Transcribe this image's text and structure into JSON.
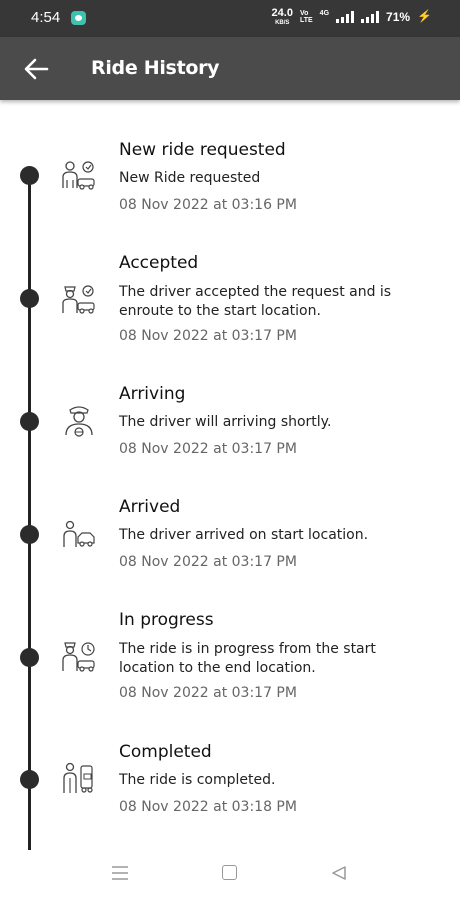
{
  "status_bar": {
    "time": "4:54",
    "speed_value": "24.0",
    "speed_unit": "KB/S",
    "volte_top": "Vo",
    "volte_bottom": "LTE",
    "network": "4G",
    "battery": "71%"
  },
  "header": {
    "title": "Ride History"
  },
  "timeline": [
    {
      "title": "New ride requested",
      "description": "New Ride requested",
      "time": "08 Nov 2022 at 03:16 PM",
      "icon": "ride-request-icon"
    },
    {
      "title": "Accepted",
      "description": "The driver accepted the request and is enroute to the start location.",
      "time": "08 Nov 2022 at 03:17 PM",
      "icon": "driver-accepted-icon"
    },
    {
      "title": "Arriving",
      "description": "The driver will arriving shortly.",
      "time": "08 Nov 2022 at 03:17 PM",
      "icon": "driver-arriving-icon"
    },
    {
      "title": "Arrived",
      "description": "The driver arrived on start location.",
      "time": "08 Nov 2022 at 03:17 PM",
      "icon": "driver-arrived-icon"
    },
    {
      "title": "In progress",
      "description": "The ride is in progress from the start location to the end location.",
      "time": "08 Nov 2022 at 03:17 PM",
      "icon": "ride-in-progress-icon"
    },
    {
      "title": "Completed",
      "description": "The ride is completed.",
      "time": "08 Nov 2022 at 03:18 PM",
      "icon": "ride-completed-icon"
    }
  ],
  "colors": {
    "app_bar": "#4b4b4b",
    "status_bar": "#373737",
    "timeline": "#222222"
  }
}
